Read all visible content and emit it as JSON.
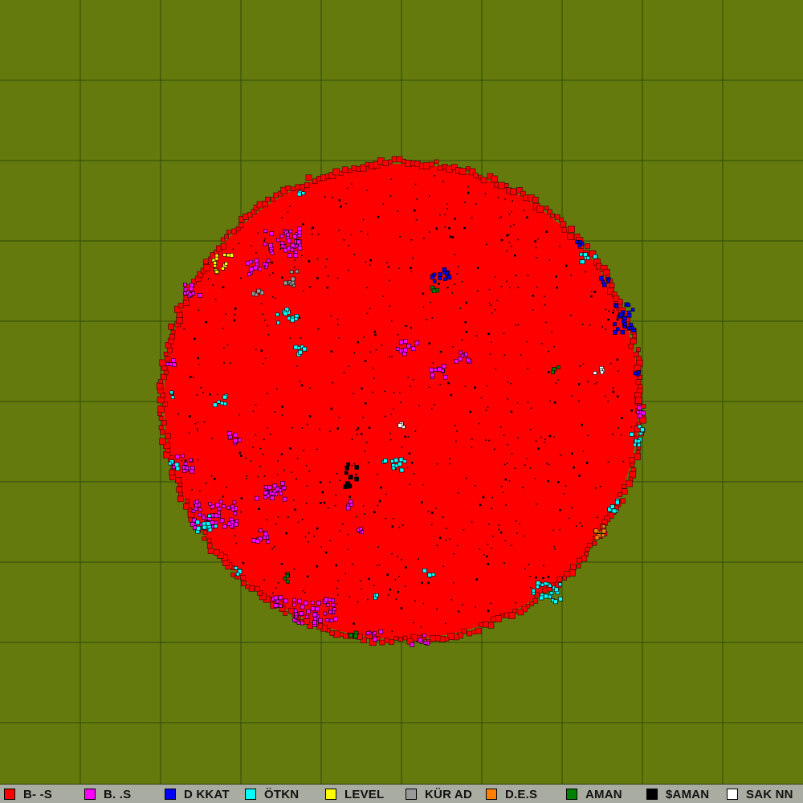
{
  "map": {
    "background_color": "#647a0c",
    "grid_color": "#2f4a0a",
    "territory_color": "#ff0000",
    "speck_color": "#000000",
    "grid_divisions": 10
  },
  "legend": {
    "items": [
      {
        "label": "B-  -S",
        "color": "#ff0000",
        "name": "red"
      },
      {
        "label": "B. .S",
        "color": "#ff00ff",
        "name": "magenta"
      },
      {
        "label": "D  KKAT",
        "color": "#0000ff",
        "name": "blue"
      },
      {
        "label": "ÖTKN",
        "color": "#00ffff",
        "name": "cyan"
      },
      {
        "label": "LEVEL",
        "color": "#ffff00",
        "name": "yellow"
      },
      {
        "label": "KÜR  AD",
        "color": "#999999",
        "name": "gray"
      },
      {
        "label": "D.E.S",
        "color": "#ff8000",
        "name": "orange"
      },
      {
        "label": "  AMAN",
        "color": "#008000",
        "name": "green"
      },
      {
        "label": "$AMAN",
        "color": "#000000",
        "name": "black"
      },
      {
        "label": "SAK  NN",
        "color": "#ffffff",
        "name": "white"
      }
    ]
  }
}
